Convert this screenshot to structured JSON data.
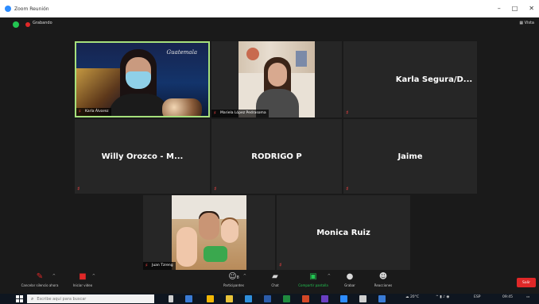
{
  "window": {
    "title": "Zoom Reunión",
    "controls": [
      "–",
      "□",
      "✕"
    ]
  },
  "topbar": {
    "recording_label": "Grabando",
    "view_label": "Vista"
  },
  "participants": {
    "karla": {
      "label": "Karla Álvarez",
      "brand": "Guatemala"
    },
    "mariela": {
      "label": "Mariela López Pedrasoma"
    },
    "karla_segura": {
      "name": "Karla Segura/D..."
    },
    "willy": {
      "name": "Willy Orozco - M..."
    },
    "rodrigo": {
      "name": "RODRIGO P"
    },
    "jaime": {
      "name": "Jaime"
    },
    "juan": {
      "label": "Juan Tzreng"
    },
    "monica": {
      "name": "Monica Ruiz"
    }
  },
  "toolbar": {
    "unmute": "Cancelar silencio ahora",
    "start_video": "Iniciar video",
    "participants": "Participantes",
    "participants_count": "8",
    "chat": "Chat",
    "share": "Compartir pantalla",
    "record": "Grabar",
    "reactions": "Reacciones",
    "leave": "Salir"
  },
  "taskbar": {
    "search_placeholder": "Escribe aquí para buscar",
    "weather": "20°C",
    "lang": "ESP",
    "time": "09:45"
  },
  "colors": {
    "active_speaker_border": "#a6e07c",
    "muted_red": "#e02828",
    "share_green": "#23c552",
    "tile_bg": "#262626"
  }
}
